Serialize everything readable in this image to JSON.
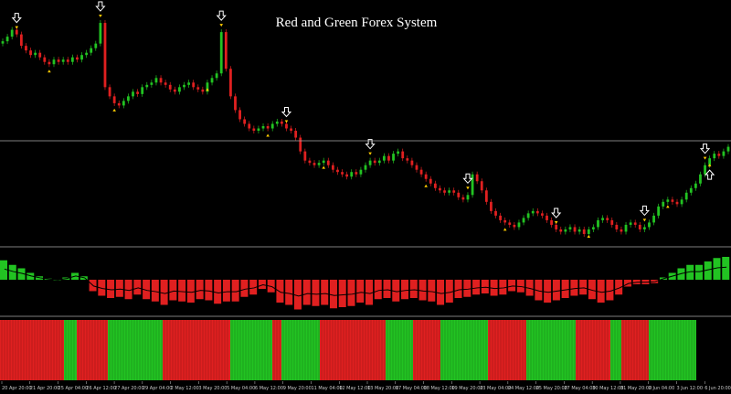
{
  "window": {
    "title": "Red and Green Forex System"
  },
  "colors": {
    "background": "#000000",
    "up": "#22c322",
    "down": "#e02020",
    "arrow_up": "#ffcc00",
    "arrow_down": "#ffcc00",
    "signal_outline": "#ffffff",
    "separator": "#a8a8a8",
    "axis_text": "#c8c8c8"
  },
  "chart_data": [
    {
      "type": "candlestick",
      "title": "Red and Green Forex System",
      "panel": "main",
      "close": [
        82,
        84,
        87,
        85,
        80,
        78,
        76,
        77,
        75,
        73,
        72,
        74,
        73,
        74,
        73,
        75,
        74,
        76,
        77,
        79,
        81,
        90,
        62,
        58,
        55,
        54,
        56,
        58,
        60,
        59,
        62,
        63,
        64,
        66,
        64,
        63,
        61,
        60,
        62,
        63,
        64,
        62,
        61,
        60,
        64,
        66,
        68,
        86,
        70,
        58,
        52,
        48,
        46,
        44,
        43,
        44,
        45,
        44,
        46,
        47,
        46,
        44,
        43,
        40,
        34,
        30,
        29,
        28,
        29,
        30,
        28,
        26,
        25,
        24,
        23,
        25,
        24,
        26,
        28,
        30,
        29,
        30,
        32,
        30,
        33,
        34,
        31,
        30,
        28,
        26,
        24,
        22,
        20,
        18,
        17,
        16,
        17,
        16,
        14,
        13,
        15,
        24,
        21,
        17,
        12,
        8,
        6,
        4,
        3,
        2,
        1,
        3,
        5,
        7,
        8,
        7,
        6,
        4,
        2,
        0,
        -1,
        0,
        1,
        -1,
        0,
        -2,
        0,
        1,
        4,
        5,
        4,
        2,
        0,
        -1,
        2,
        3,
        2,
        0,
        1,
        3,
        6,
        10,
        12,
        13,
        12,
        11,
        13,
        16,
        18,
        20,
        24,
        28,
        31,
        33,
        32,
        34,
        36
      ],
      "signals_down": [
        3,
        21,
        47,
        61,
        79,
        100,
        119,
        138,
        151
      ],
      "signals_up": [
        10,
        24,
        44,
        57,
        69,
        91,
        108,
        126,
        143,
        152
      ]
    },
    {
      "type": "histogram",
      "panel": "oscillator",
      "values": [
        1.7,
        1.3,
        1.0,
        0.6,
        0.3,
        0.1,
        0.0,
        0.2,
        0.6,
        0.3,
        -1.0,
        -1.4,
        -1.6,
        -1.5,
        -1.7,
        -1.3,
        -1.7,
        -1.9,
        -2.2,
        -1.8,
        -1.9,
        -2.0,
        -1.7,
        -1.8,
        -2.1,
        -1.9,
        -1.9,
        -1.5,
        -1.3,
        -0.8,
        -1.1,
        -2.0,
        -2.2,
        -2.6,
        -2.2,
        -2.3,
        -2.2,
        -2.5,
        -2.4,
        -2.3,
        -2.0,
        -2.2,
        -1.7,
        -1.6,
        -1.9,
        -1.7,
        -1.6,
        -1.8,
        -1.9,
        -2.2,
        -2.0,
        -1.6,
        -1.5,
        -1.3,
        -1.2,
        -1.4,
        -1.3,
        -1.0,
        -1.1,
        -1.4,
        -1.8,
        -2.0,
        -1.8,
        -1.6,
        -1.4,
        -1.3,
        -1.7,
        -2.0,
        -1.8,
        -1.3,
        -0.6,
        -0.4,
        -0.4,
        -0.3,
        0.2,
        0.6,
        1.0,
        1.3,
        1.3,
        1.6,
        1.9,
        2.0
      ],
      "zero_line": 0
    },
    {
      "type": "heatmap",
      "panel": "trend_bar",
      "segments": [
        "down",
        "up",
        "down",
        "up",
        "down",
        "up",
        "down",
        "up",
        "down",
        "up",
        "down",
        "up",
        "down",
        "up",
        "down",
        "up",
        "down",
        "up"
      ],
      "widths": [
        70,
        14,
        34,
        60,
        74,
        46,
        10,
        42,
        72,
        30,
        30,
        52,
        42,
        54,
        38,
        12,
        30,
        52
      ]
    }
  ],
  "x_axis": {
    "ticks": [
      "20 Apr 20:00",
      "21 Apr 20:00",
      "25 Apr 04:00",
      "26 Apr 12:00",
      "27 Apr 20:00",
      "29 Apr 04:00",
      "2 May 12:00",
      "3 May 20:00",
      "5 May 04:00",
      "6 May 12:00",
      "9 May 20:00",
      "11 May 04:00",
      "12 May 12:00",
      "13 May 20:00",
      "17 May 04:00",
      "18 May 12:00",
      "19 May 20:00",
      "23 May 04:00",
      "24 May 12:00",
      "25 May 20:00",
      "27 May 04:00",
      "30 May 12:00",
      "31 May 20:00",
      "2 Jun 04:00",
      "3 Jun 12:00",
      "6 Jun 20:00"
    ]
  }
}
